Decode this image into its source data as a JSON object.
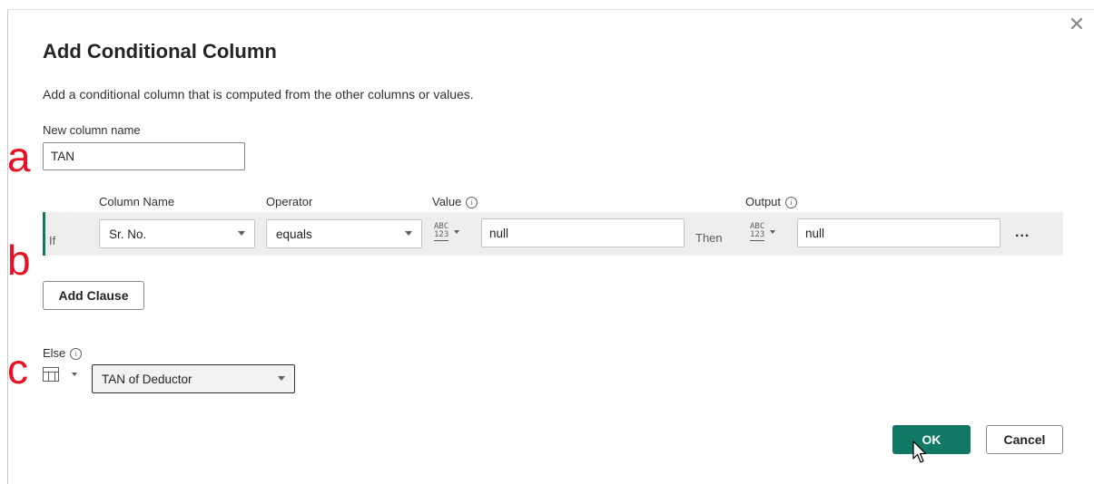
{
  "dialog": {
    "title": "Add Conditional Column",
    "description": "Add a conditional column that is computed from the other columns or values.",
    "close_icon": "close-icon"
  },
  "new_column": {
    "label": "New column name",
    "value": "TAN"
  },
  "annotations": {
    "a": "a",
    "b": "b",
    "c": "c"
  },
  "clause_headers": {
    "column_name": "Column Name",
    "operator": "Operator",
    "value": "Value",
    "output": "Output"
  },
  "clause": {
    "if_label": "If",
    "column_name": "Sr. No.",
    "operator": "equals",
    "value_type_top": "ABC",
    "value_type_bottom": "123",
    "value": "null",
    "then_label": "Then",
    "output_type_top": "ABC",
    "output_type_bottom": "123",
    "output": "null",
    "more_label": "..."
  },
  "add_clause_label": "Add Clause",
  "else": {
    "label": "Else",
    "value": "TAN of Deductor",
    "type_icon": "table-icon"
  },
  "buttons": {
    "ok": "OK",
    "cancel": "Cancel"
  },
  "colors": {
    "accent": "#117865",
    "annotation": "#e81123"
  }
}
